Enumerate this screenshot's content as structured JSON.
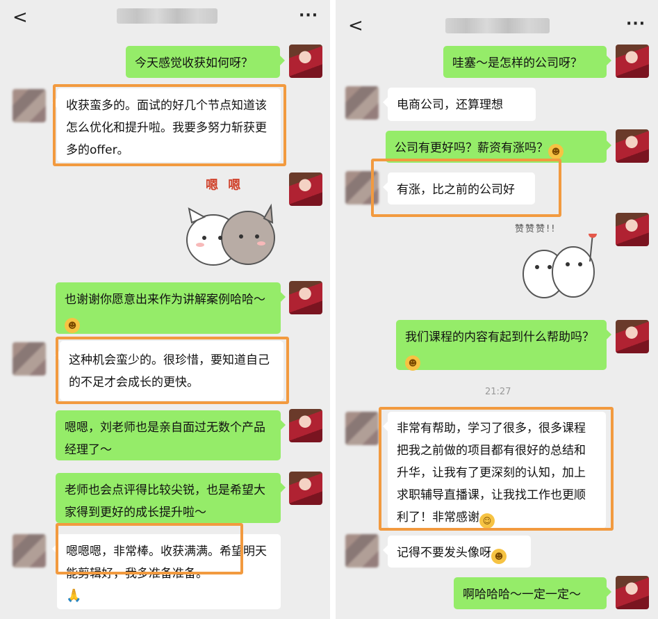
{
  "left": {
    "nav": {
      "back": "<",
      "more": "···"
    },
    "messages": [
      {
        "text": "今天感觉收获如何呀？"
      },
      {
        "text": "收获蛮多的。面试的好几个节点知道该怎么优化和提升啦。我要多努力斩获更多的offer。"
      },
      {
        "sticker": "嗯 嗯"
      },
      {
        "text": "也谢谢你愿意出来作为讲解案例哈哈～"
      },
      {
        "text": "这种机会蛮少的。很珍惜，要知道自己的不足才会成长的更快。"
      },
      {
        "text": "嗯嗯，刘老师也是亲自面过无数个产品经理了～"
      },
      {
        "text": "老师也会点评得比较尖锐，也是希望大家得到更好的成长提升啦～"
      },
      {
        "text": "嗯嗯嗯，非常棒。收获满满。希望明天能剪辑好，我多准备准备。"
      }
    ]
  },
  "right": {
    "nav": {
      "back": "<",
      "more": "···"
    },
    "timestamp": "21:27",
    "messages": [
      {
        "text": "哇塞～是怎样的公司呀？"
      },
      {
        "text": "电商公司，还算理想"
      },
      {
        "text": "公司有更好吗？薪资有涨吗？"
      },
      {
        "text": "有涨，比之前的公司好"
      },
      {
        "sticker": "赞赞赞!!"
      },
      {
        "text": "我们课程的内容有起到什么帮助吗？"
      },
      {
        "text": "非常有帮助，学习了很多，很多课程把我之前做的项目都有很好的总结和升华，让我有了更深刻的认知，加上求职辅导直播课，让我找工作也更顺利了！非常感谢"
      },
      {
        "text": "记得不要发头像呀"
      },
      {
        "text": "啊哈哈哈～一定一定～"
      }
    ]
  },
  "colors": {
    "sent": "#95ec69",
    "received": "#ffffff",
    "highlight": "#f29a3f",
    "background": "#ededed"
  },
  "icons": [
    "back-arrow-icon",
    "more-icon",
    "grin-emoji-icon",
    "laugh-cry-emoji-icon",
    "folded-hands-emoji-icon"
  ]
}
